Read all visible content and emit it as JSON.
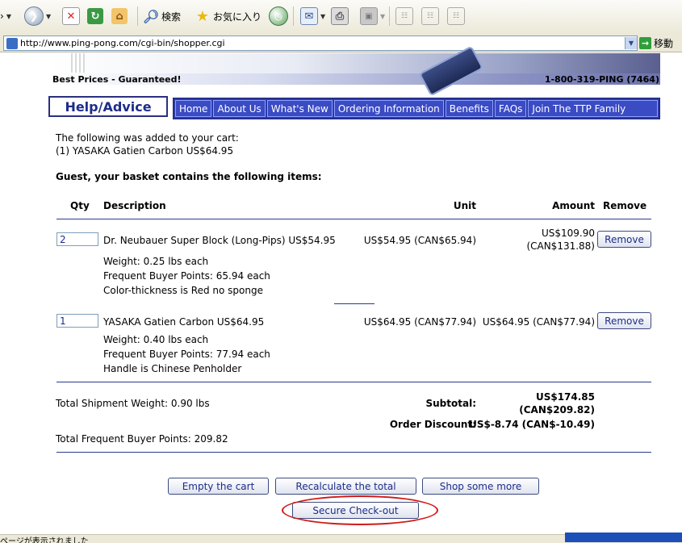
{
  "browser": {
    "search_label": "検索",
    "favorites_label": "お気に入り",
    "address": "http://www.ping-pong.com/cgi-bin/shopper.cgi",
    "go_label": "移動",
    "status": "ページが表示されました"
  },
  "header": {
    "tagline": "Best Prices - Guaranteed!",
    "phone": "1-800-319-PING (7464)",
    "help_advice": "Help/Advice",
    "nav": [
      "Home",
      "About Us",
      "What's New",
      "Ordering Information",
      "Benefits",
      "FAQs",
      "Join The TTP Family"
    ]
  },
  "cart": {
    "added_msg": "The following was added to your cart:",
    "added_item": "(1) YASAKA Gatien Carbon US$64.95",
    "basket_heading": "Guest, your basket contains the following items:",
    "columns": {
      "qty": "Qty",
      "description": "Description",
      "unit": "Unit",
      "amount": "Amount",
      "remove": "Remove"
    },
    "items": [
      {
        "qty": "2",
        "name": "Dr. Neubauer Super Block (Long-Pips) US$54.95",
        "weight": "Weight: 0.25 lbs each",
        "points": "Frequent Buyer Points: 65.94 each",
        "option": "Color-thickness is Red no sponge",
        "unit": "US$54.95 (CAN$65.94)",
        "amount_us": "US$109.90",
        "amount_can": "(CAN$131.88)",
        "remove": "Remove"
      },
      {
        "qty": "1",
        "name": "YASAKA Gatien Carbon US$64.95",
        "weight": "Weight: 0.40 lbs each",
        "points": "Frequent Buyer Points: 77.94 each",
        "option": "Handle is Chinese Penholder",
        "unit": "US$64.95 (CAN$77.94)",
        "amount": "US$64.95 (CAN$77.94)",
        "remove": "Remove"
      }
    ],
    "total_weight": "Total Shipment Weight: 0.90 lbs",
    "subtotal_label": "Subtotal:",
    "subtotal_us": "US$174.85",
    "subtotal_can": "(CAN$209.82)",
    "discount_label": "Order Discount:",
    "discount": "US$-8.74 (CAN$-10.49)",
    "total_points": "Total Frequent Buyer Points: 209.82"
  },
  "actions": {
    "empty": "Empty the cart",
    "recalc": "Recalculate the total",
    "shop": "Shop some more",
    "checkout": "Secure Check-out"
  },
  "colors": {
    "nav_blue": "#2b3aa5",
    "header_text": "#1d2c8a",
    "highlight_ring": "#d11a1a"
  }
}
